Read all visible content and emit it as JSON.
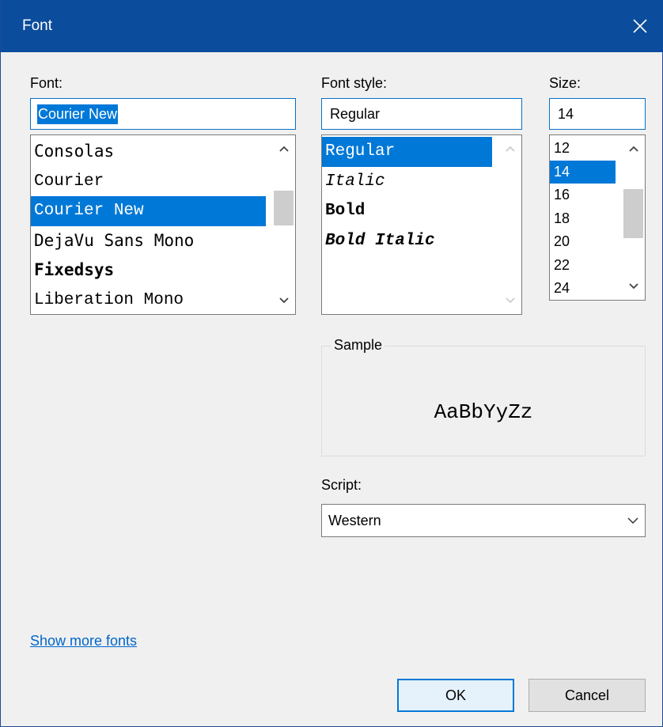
{
  "window": {
    "title": "Font"
  },
  "font": {
    "label": "Font:",
    "value": "Courier New",
    "items": [
      {
        "label": "Consolas",
        "style": "monosans"
      },
      {
        "label": "Courier",
        "style": "mono"
      },
      {
        "label": "Courier New",
        "style": "mono",
        "selected": true
      },
      {
        "label": "DejaVu Sans Mono",
        "style": "monosans"
      },
      {
        "label": "Fixedsys",
        "style": "bold"
      },
      {
        "label": "Liberation Mono",
        "style": "mono"
      }
    ]
  },
  "style": {
    "label": "Font style:",
    "value": "Regular",
    "items": [
      {
        "label": "Regular",
        "selected": true
      },
      {
        "label": "Italic"
      },
      {
        "label": "Bold"
      },
      {
        "label": "Bold Italic"
      }
    ]
  },
  "size": {
    "label": "Size:",
    "value": "14",
    "items": [
      "12",
      "14",
      "16",
      "18",
      "20",
      "22",
      "24"
    ],
    "selected_index": 1
  },
  "sample": {
    "legend": "Sample",
    "text": "AaBbYyZz"
  },
  "script": {
    "label": "Script:",
    "value": "Western"
  },
  "links": {
    "show_more": "Show more fonts"
  },
  "buttons": {
    "ok": "OK",
    "cancel": "Cancel"
  },
  "colors": {
    "titlebar": "#0c4c9c",
    "selection": "#0078d7",
    "link": "#0066cc"
  }
}
